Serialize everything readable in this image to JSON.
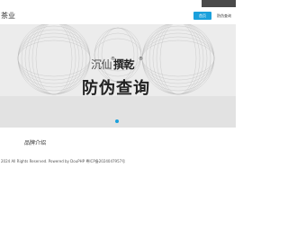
{
  "header": {
    "logo_text": "茶业",
    "topbar_text": "",
    "nav": [
      {
        "label": "首页",
        "active": true
      },
      {
        "label": "防伪查询",
        "active": false
      }
    ]
  },
  "banner": {
    "brand_left": "沉仙",
    "brand_right": "撰乾",
    "title": "防伪查询",
    "carousel_dots": 1,
    "active_dot_color": "#1aa0dc"
  },
  "section": {
    "title": "品牌介绍"
  },
  "footer": {
    "text": "2024 All Rights Reserved. Powered by DouPHP 粤ICP备2024047957号"
  },
  "colors": {
    "accent": "#1aa0dc",
    "banner_bg": "#ececec"
  }
}
